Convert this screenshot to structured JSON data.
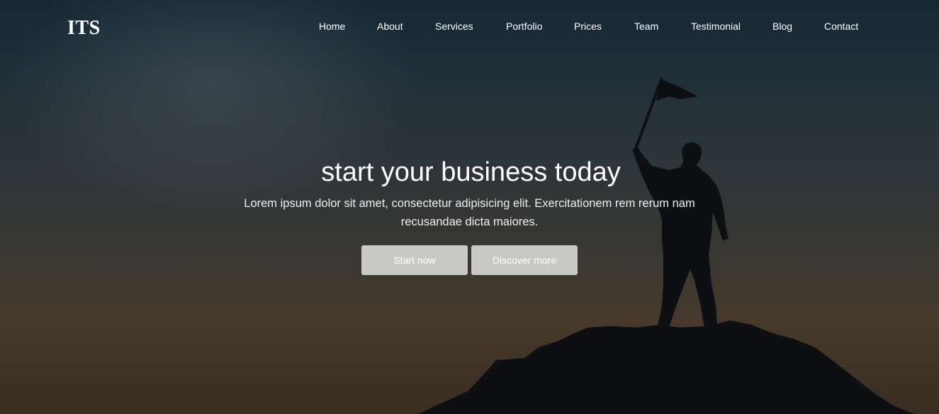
{
  "brand": {
    "logo": "ITS"
  },
  "nav": {
    "items": [
      {
        "label": "Home"
      },
      {
        "label": "About"
      },
      {
        "label": "Services"
      },
      {
        "label": "Portfolio"
      },
      {
        "label": "Prices"
      },
      {
        "label": "Team"
      },
      {
        "label": "Testimonial"
      },
      {
        "label": "Blog"
      },
      {
        "label": "Contact"
      }
    ]
  },
  "hero": {
    "title": "start your business today",
    "text": "Lorem ipsum dolor sit amet, consectetur adipisicing elit. Exercitationem rem rerum nam recusandae dicta maiores.",
    "primary_button": "Start now",
    "secondary_button": "Discover more"
  },
  "colors": {
    "sky_top": "#1d3442",
    "sky_bottom": "#5a4a38",
    "silhouette": "#0d0f12",
    "button_bg": "#c8c8c6",
    "text": "#ffffff"
  }
}
